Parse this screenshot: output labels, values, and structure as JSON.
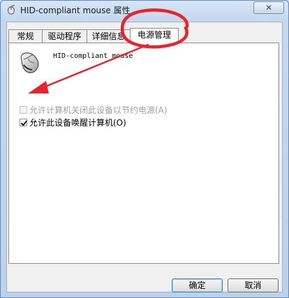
{
  "window": {
    "title": "HID-compliant mouse 属性",
    "close_glyph": "✕"
  },
  "tabs": [
    {
      "label": "常规",
      "active": false
    },
    {
      "label": "驱动程序",
      "active": false
    },
    {
      "label": "详细信息",
      "active": false
    },
    {
      "label": "电源管理",
      "active": true
    }
  ],
  "device": {
    "name": "HID-compliant mouse",
    "icon": "mouse-icon"
  },
  "options": [
    {
      "label": "允许计算机关闭此设备以节约电源(A)",
      "checked": false,
      "enabled": false
    },
    {
      "label": "允许此设备唤醒计算机(O)",
      "checked": true,
      "enabled": true
    }
  ],
  "buttons": {
    "ok": "确定",
    "cancel": "取消"
  },
  "annotation_color": "#e8242a"
}
